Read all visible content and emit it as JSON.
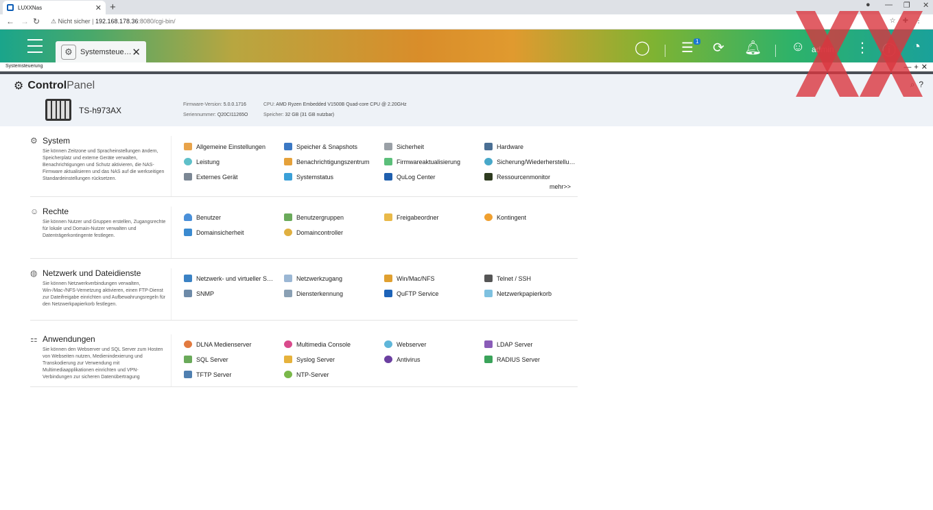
{
  "browser": {
    "tab_title": "LUXXNas",
    "new_tab": "+",
    "close": "✕",
    "not_secure": "Nicht sicher",
    "url_host": "192.168.178.36",
    "url_rest": ":8080/cgi-bin/"
  },
  "header": {
    "app_tab": "Systemsteue…",
    "badge": "1",
    "user": "admin"
  },
  "window": {
    "title": "Systemsteuerung"
  },
  "control_panel": {
    "title_bold": "Control",
    "title_thin": "Panel",
    "model": "TS-h973AX",
    "firmware_label": "Firmware-Version:",
    "firmware_value": "5.0.0.1716",
    "serial_label": "Seriennummer:",
    "serial_value": "Q20CI11265O",
    "cpu_label": "CPU:",
    "cpu_value": "AMD Ryzen Embedded V1500B Quad-core CPU @ 2.20GHz",
    "mem_label": "Speicher:",
    "mem_value": "32 GB (31 GB nutzbar)"
  },
  "sections": [
    {
      "title": "System",
      "description": "Sie können Zeitzone und Spracheinstellungen ändern, Speicherplatz und externe Geräte verwalten, Benachrichtigungen und Schutz aktivieren, die NAS-Firmware aktualisieren und das NAS auf die werkseitigen Standardeinstellungen rücksetzen.",
      "items": [
        "Allgemeine Einstellungen",
        "Speicher & Snapshots",
        "Sicherheit",
        "Hardware",
        "Leistung",
        "Benachrichtigungszentrum",
        "Firmwareaktualisierung",
        "Sicherung/Wiederherstellu…",
        "Externes Gerät",
        "Systemstatus",
        "QuLog Center",
        "Ressourcenmonitor"
      ],
      "more": "mehr>>"
    },
    {
      "title": "Rechte",
      "description": "Sie können Nutzer und Gruppen erstellen, Zugangsrechte für lokale und Domain-Nutzer verwalten und Datenträgerkontingente festlegen.",
      "items": [
        "Benutzer",
        "Benutzergruppen",
        "Freigabeordner",
        "Kontingent",
        "Domainsicherheit",
        "Domaincontroller"
      ]
    },
    {
      "title": "Netzwerk und Dateidienste",
      "description": "Sie können Netzwerkverbindungen verwalten, Win-/Mac-/NFS-Vernetzung aktivieren, einen FTP-Dienst zur Dateifreigabe einrichten und Aufbewahrungsregeln für den Netzwerkpapierkorb festlegen.",
      "items": [
        "Netzwerk- und virtueller S…",
        "Netzwerkzugang",
        "Win/Mac/NFS",
        "Telnet / SSH",
        "SNMP",
        "Diensterkennung",
        "QuFTP Service",
        "Netzwerkpapierkorb"
      ]
    },
    {
      "title": "Anwendungen",
      "description": "Sie können den Webserver und SQL Server zum Hosten von Webseiten nutzen, Medienindexierung und Transkodierung zur Verwendung mit Multimediaapplikationen einrichten und VPN-Verbindungen zur sicheren Datenübertragung",
      "items": [
        "DLNA Medienserver",
        "Multimedia Console",
        "Webserver",
        "LDAP Server",
        "SQL Server",
        "Syslog Server",
        "Antivirus",
        "RADIUS Server",
        "TFTP Server",
        "NTP-Server"
      ]
    }
  ],
  "colors": {
    "accent": "#1aa58b",
    "watermark": "#d9363e"
  }
}
